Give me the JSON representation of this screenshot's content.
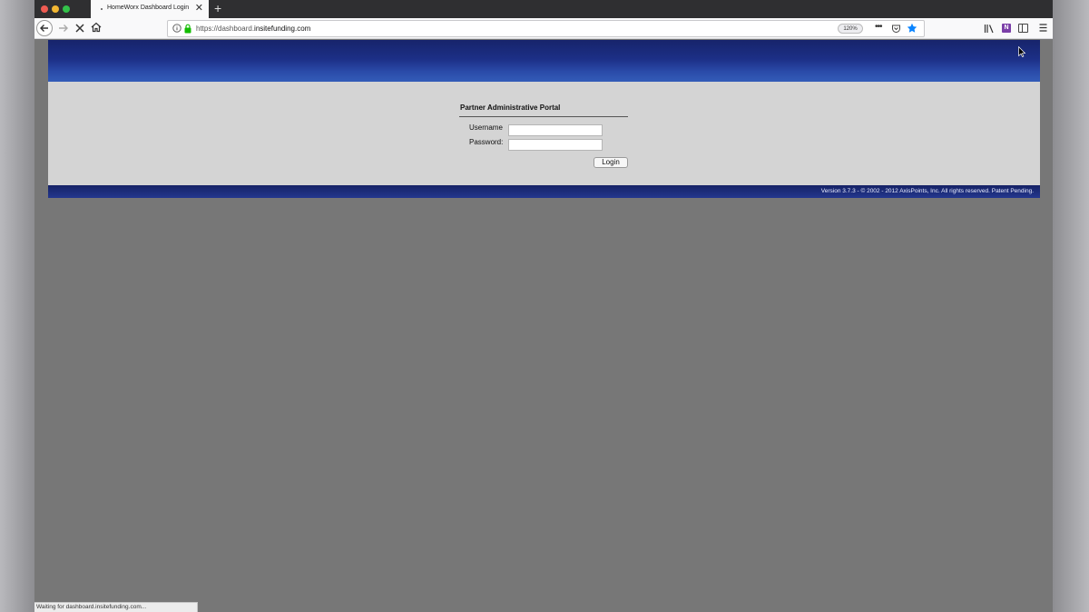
{
  "browser": {
    "tab_title": "HomeWorx Dashboard Login",
    "tab_close_glyph": "✕",
    "new_tab_glyph": "+",
    "url_prefix": "https://dashboard.",
    "url_domain": "insitefunding.com",
    "zoom": "120%",
    "more_glyph": "•••",
    "onenote_glyph": "N",
    "status_text": "Waiting for dashboard.insitefunding.com..."
  },
  "icons": {
    "back": "arrow-left-icon",
    "forward": "arrow-right-icon",
    "stop": "stop-x-icon",
    "home": "home-icon",
    "info": "info-icon",
    "lock": "lock-icon",
    "pocket": "pocket-icon",
    "bookmark": "star-icon",
    "library": "library-icon",
    "onenote": "onenote-icon",
    "sidebar": "sidebar-icon",
    "menu": "hamburger-menu-icon"
  },
  "colors": {
    "header_blue": "#1c2f86",
    "body_gray": "#d4d4d4",
    "star_blue": "#0a84ff",
    "lock_green": "#12bc00"
  },
  "login": {
    "title": "Partner Administrative Portal",
    "username_label": "Username",
    "password_label": "Password:",
    "username_value": "",
    "password_value": "",
    "button_label": "Login"
  },
  "footer": {
    "text": "Version 3.7.3 - © 2002 - 2012 AxisPoints, Inc. All rights reserved. Patent Pending."
  }
}
